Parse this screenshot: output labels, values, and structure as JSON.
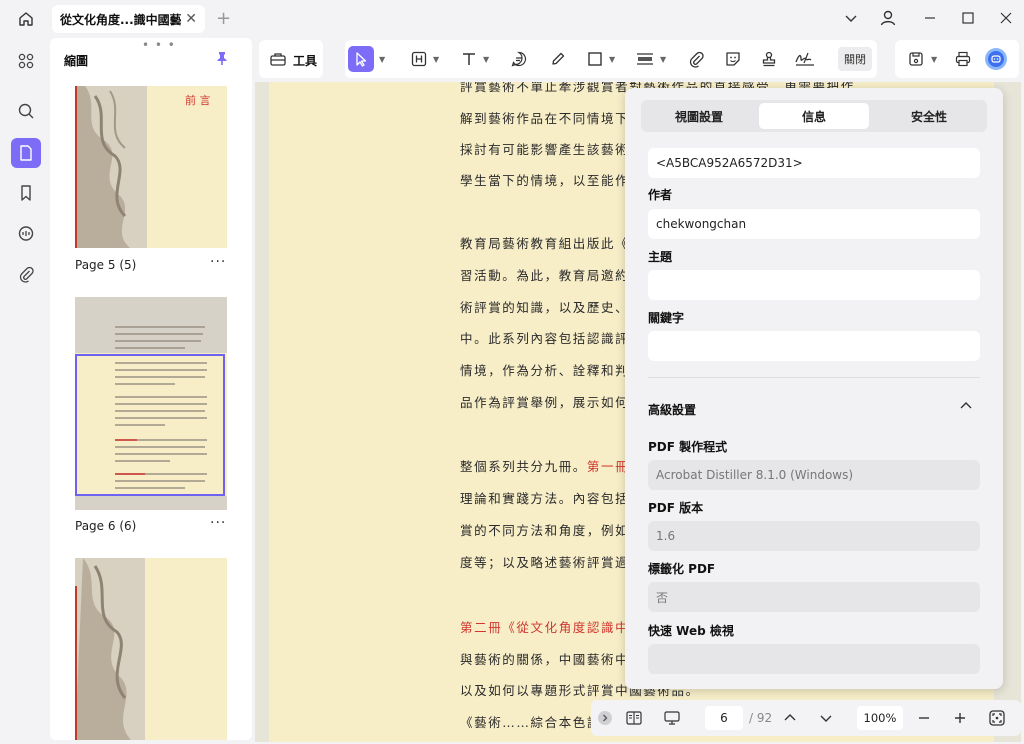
{
  "tab": {
    "title": "從文化角度...識中國藝術"
  },
  "thumbnails": {
    "title": "縮圖",
    "pages": [
      {
        "label": "Page 5 (5)",
        "heading": "前 言"
      },
      {
        "label": "Page 6 (6)"
      }
    ]
  },
  "toolbar": {
    "tools_label": "工具",
    "close_label": "關閉"
  },
  "document": {
    "lines": [
      {
        "text": "評賞藝術不單止牽涉觀賞者對藝術作品的直接感受，更需要把作",
        "red": false
      },
      {
        "text": "解到藝術作品在不同情境下會",
        "red": false
      },
      {
        "text": "採討有可能影響產生該藝術作",
        "red": false
      },
      {
        "text": "學生當下的情境，以至能作出",
        "red": false
      },
      {
        "text": "教育局藝術教育組出版此《藝",
        "red": false
      },
      {
        "text": "習活動。為此，教育局邀約了",
        "red": false
      },
      {
        "text": "術評賞的知識，以及歷史、文",
        "red": false
      },
      {
        "text": "中。此系列內容包括認識評賞",
        "red": false
      },
      {
        "text": "情境，作為分析、詮釋和判斷",
        "red": false
      },
      {
        "text": "品作為評賞舉例，展示如何選",
        "red": false
      },
      {
        "text": "整個系列共分九冊。",
        "red": false,
        "suffix": "第一冊《",
        "suffix_red": true
      },
      {
        "text": "理論和實踐方法。內容包括簡",
        "red": false
      },
      {
        "text": "賞的不同方法和角度，例如觀",
        "red": false
      },
      {
        "text": "度等；以及略述藝術評賞過程",
        "red": false
      },
      {
        "text": "第二冊《從文化角度認識中國",
        "red": true
      },
      {
        "text": "與藝術的關係，中國藝術中蘊",
        "red": false
      },
      {
        "text": "以及如何以專題形式評賞中國藝術品。",
        "red": false
      },
      {
        "text": "《藝術……綜合本色評賞藝術",
        "red": false
      }
    ]
  },
  "info_panel": {
    "tabs": [
      "視圖設置",
      "信息",
      "安全性"
    ],
    "active_tab": "信息",
    "id_value": "<A5BCA952A6572D31>",
    "author_label": "作者",
    "author_value": "chekwongchan",
    "subject_label": "主題",
    "subject_value": "",
    "keywords_label": "關鍵字",
    "keywords_value": "",
    "advanced_label": "高級設置",
    "producer_label": "PDF 製作程式",
    "producer_value": "Acrobat Distiller 8.1.0 (Windows)",
    "version_label": "PDF 版本",
    "version_value": "1.6",
    "tagged_label": "標籤化 PDF",
    "tagged_value": "否",
    "fastweb_label": "快速 Web 檢視",
    "fastweb_value": ""
  },
  "nav": {
    "current_page": "6",
    "total_pages": "/ 92",
    "zoom": "100%"
  },
  "colors": {
    "accent": "#7c6cf6",
    "doc_bg": "#f7eec8",
    "red_text": "#d0362f"
  }
}
